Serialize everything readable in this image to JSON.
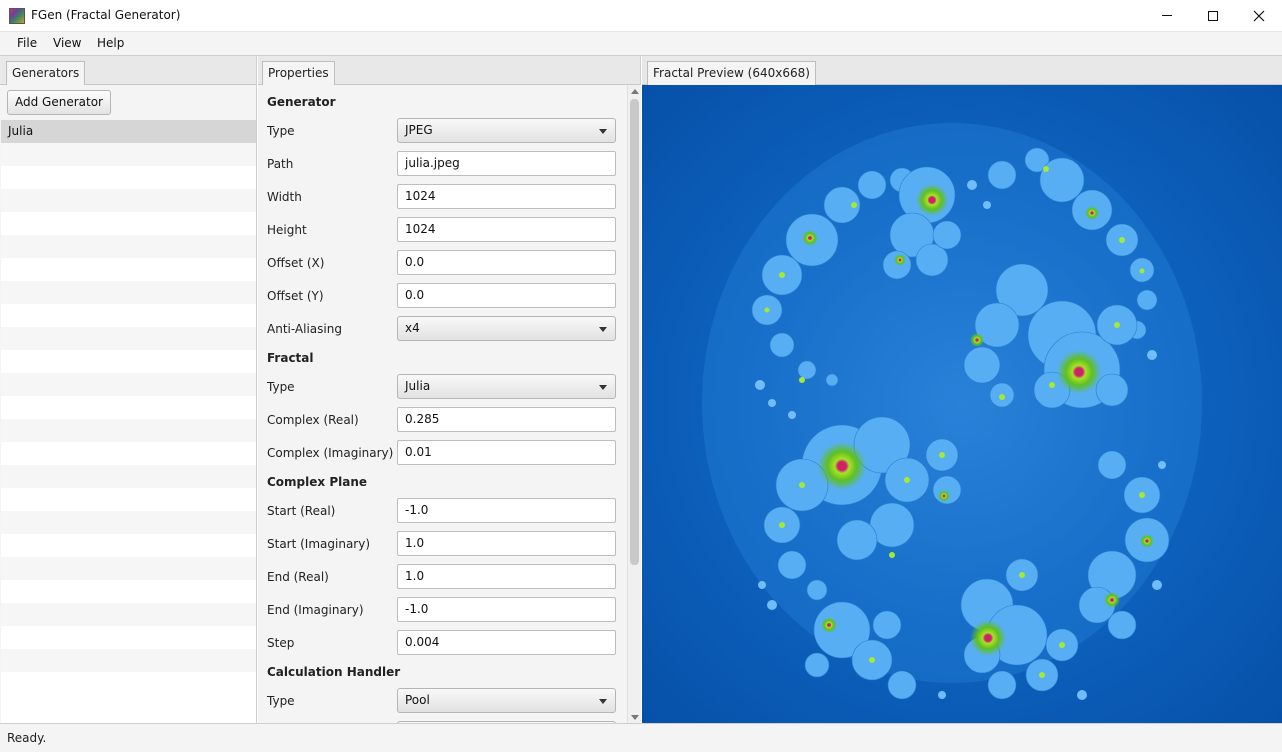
{
  "window": {
    "title": "FGen (Fractal Generator)"
  },
  "menu": [
    "File",
    "View",
    "Help"
  ],
  "generators": {
    "tab": "Generators",
    "add_button": "Add Generator",
    "items": [
      "Julia"
    ]
  },
  "properties": {
    "tab": "Properties",
    "generator": {
      "heading": "Generator",
      "type": {
        "label": "Type",
        "value": "JPEG"
      },
      "path": {
        "label": "Path",
        "value": "julia.jpeg"
      },
      "width": {
        "label": "Width",
        "value": "1024"
      },
      "height": {
        "label": "Height",
        "value": "1024"
      },
      "offset_x": {
        "label": "Offset (X)",
        "value": "0.0"
      },
      "offset_y": {
        "label": "Offset (Y)",
        "value": "0.0"
      },
      "anti_aliasing": {
        "label": "Anti-Aliasing",
        "value": "x4"
      }
    },
    "fractal": {
      "heading": "Fractal",
      "type": {
        "label": "Type",
        "value": "Julia"
      },
      "complex_real": {
        "label": "Complex (Real)",
        "value": "0.285"
      },
      "complex_imag": {
        "label": "Complex (Imaginary)",
        "value": "0.01"
      }
    },
    "complex_plane": {
      "heading": "Complex Plane",
      "start_real": {
        "label": "Start (Real)",
        "value": "-1.0"
      },
      "start_imag": {
        "label": "Start (Imaginary)",
        "value": "1.0"
      },
      "end_real": {
        "label": "End  (Real)",
        "value": "1.0"
      },
      "end_imag": {
        "label": "End (Imaginary)",
        "value": "-1.0"
      },
      "step": {
        "label": "Step",
        "value": "0.004"
      }
    },
    "calculation_handler": {
      "heading": "Calculation Handler",
      "type": {
        "label": "Type",
        "value": "Pool"
      }
    }
  },
  "preview": {
    "tab": "Fractal Preview (640x668)"
  },
  "status": "Ready.",
  "colors": {
    "preview_bg": "#0e64c0",
    "fractal_body": "#4aa8f0",
    "fractal_core": "#7ed321",
    "fractal_center": "#d0206a"
  }
}
